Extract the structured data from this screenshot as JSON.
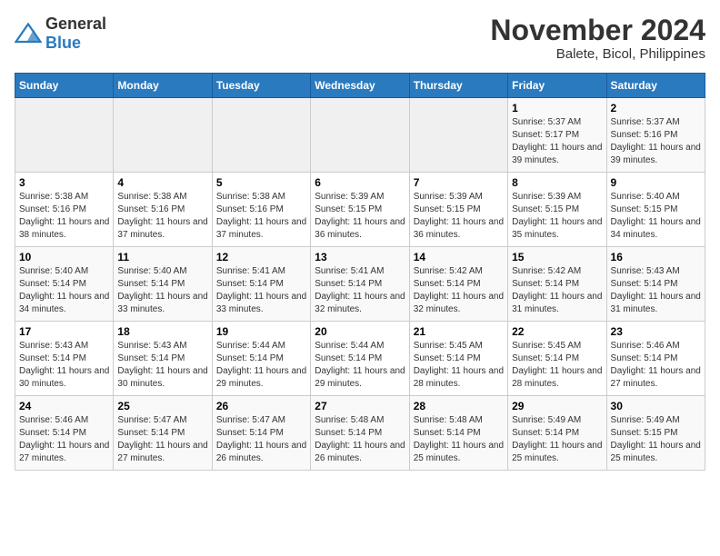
{
  "header": {
    "logo_general": "General",
    "logo_blue": "Blue",
    "title": "November 2024",
    "subtitle": "Balete, Bicol, Philippines"
  },
  "columns": [
    "Sunday",
    "Monday",
    "Tuesday",
    "Wednesday",
    "Thursday",
    "Friday",
    "Saturday"
  ],
  "weeks": [
    [
      {
        "day": "",
        "info": ""
      },
      {
        "day": "",
        "info": ""
      },
      {
        "day": "",
        "info": ""
      },
      {
        "day": "",
        "info": ""
      },
      {
        "day": "",
        "info": ""
      },
      {
        "day": "1",
        "info": "Sunrise: 5:37 AM\nSunset: 5:17 PM\nDaylight: 11 hours and 39 minutes."
      },
      {
        "day": "2",
        "info": "Sunrise: 5:37 AM\nSunset: 5:16 PM\nDaylight: 11 hours and 39 minutes."
      }
    ],
    [
      {
        "day": "3",
        "info": "Sunrise: 5:38 AM\nSunset: 5:16 PM\nDaylight: 11 hours and 38 minutes."
      },
      {
        "day": "4",
        "info": "Sunrise: 5:38 AM\nSunset: 5:16 PM\nDaylight: 11 hours and 37 minutes."
      },
      {
        "day": "5",
        "info": "Sunrise: 5:38 AM\nSunset: 5:16 PM\nDaylight: 11 hours and 37 minutes."
      },
      {
        "day": "6",
        "info": "Sunrise: 5:39 AM\nSunset: 5:15 PM\nDaylight: 11 hours and 36 minutes."
      },
      {
        "day": "7",
        "info": "Sunrise: 5:39 AM\nSunset: 5:15 PM\nDaylight: 11 hours and 36 minutes."
      },
      {
        "day": "8",
        "info": "Sunrise: 5:39 AM\nSunset: 5:15 PM\nDaylight: 11 hours and 35 minutes."
      },
      {
        "day": "9",
        "info": "Sunrise: 5:40 AM\nSunset: 5:15 PM\nDaylight: 11 hours and 34 minutes."
      }
    ],
    [
      {
        "day": "10",
        "info": "Sunrise: 5:40 AM\nSunset: 5:14 PM\nDaylight: 11 hours and 34 minutes."
      },
      {
        "day": "11",
        "info": "Sunrise: 5:40 AM\nSunset: 5:14 PM\nDaylight: 11 hours and 33 minutes."
      },
      {
        "day": "12",
        "info": "Sunrise: 5:41 AM\nSunset: 5:14 PM\nDaylight: 11 hours and 33 minutes."
      },
      {
        "day": "13",
        "info": "Sunrise: 5:41 AM\nSunset: 5:14 PM\nDaylight: 11 hours and 32 minutes."
      },
      {
        "day": "14",
        "info": "Sunrise: 5:42 AM\nSunset: 5:14 PM\nDaylight: 11 hours and 32 minutes."
      },
      {
        "day": "15",
        "info": "Sunrise: 5:42 AM\nSunset: 5:14 PM\nDaylight: 11 hours and 31 minutes."
      },
      {
        "day": "16",
        "info": "Sunrise: 5:43 AM\nSunset: 5:14 PM\nDaylight: 11 hours and 31 minutes."
      }
    ],
    [
      {
        "day": "17",
        "info": "Sunrise: 5:43 AM\nSunset: 5:14 PM\nDaylight: 11 hours and 30 minutes."
      },
      {
        "day": "18",
        "info": "Sunrise: 5:43 AM\nSunset: 5:14 PM\nDaylight: 11 hours and 30 minutes."
      },
      {
        "day": "19",
        "info": "Sunrise: 5:44 AM\nSunset: 5:14 PM\nDaylight: 11 hours and 29 minutes."
      },
      {
        "day": "20",
        "info": "Sunrise: 5:44 AM\nSunset: 5:14 PM\nDaylight: 11 hours and 29 minutes."
      },
      {
        "day": "21",
        "info": "Sunrise: 5:45 AM\nSunset: 5:14 PM\nDaylight: 11 hours and 28 minutes."
      },
      {
        "day": "22",
        "info": "Sunrise: 5:45 AM\nSunset: 5:14 PM\nDaylight: 11 hours and 28 minutes."
      },
      {
        "day": "23",
        "info": "Sunrise: 5:46 AM\nSunset: 5:14 PM\nDaylight: 11 hours and 27 minutes."
      }
    ],
    [
      {
        "day": "24",
        "info": "Sunrise: 5:46 AM\nSunset: 5:14 PM\nDaylight: 11 hours and 27 minutes."
      },
      {
        "day": "25",
        "info": "Sunrise: 5:47 AM\nSunset: 5:14 PM\nDaylight: 11 hours and 27 minutes."
      },
      {
        "day": "26",
        "info": "Sunrise: 5:47 AM\nSunset: 5:14 PM\nDaylight: 11 hours and 26 minutes."
      },
      {
        "day": "27",
        "info": "Sunrise: 5:48 AM\nSunset: 5:14 PM\nDaylight: 11 hours and 26 minutes."
      },
      {
        "day": "28",
        "info": "Sunrise: 5:48 AM\nSunset: 5:14 PM\nDaylight: 11 hours and 25 minutes."
      },
      {
        "day": "29",
        "info": "Sunrise: 5:49 AM\nSunset: 5:14 PM\nDaylight: 11 hours and 25 minutes."
      },
      {
        "day": "30",
        "info": "Sunrise: 5:49 AM\nSunset: 5:15 PM\nDaylight: 11 hours and 25 minutes."
      }
    ]
  ]
}
